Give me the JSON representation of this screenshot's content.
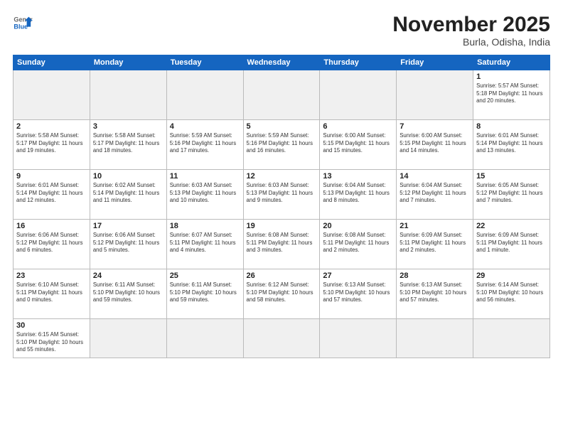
{
  "logo": {
    "general": "General",
    "blue": "Blue"
  },
  "header": {
    "month": "November 2025",
    "location": "Burla, Odisha, India"
  },
  "weekdays": [
    "Sunday",
    "Monday",
    "Tuesday",
    "Wednesday",
    "Thursday",
    "Friday",
    "Saturday"
  ],
  "days": [
    {
      "num": "",
      "info": ""
    },
    {
      "num": "",
      "info": ""
    },
    {
      "num": "",
      "info": ""
    },
    {
      "num": "",
      "info": ""
    },
    {
      "num": "",
      "info": ""
    },
    {
      "num": "",
      "info": ""
    },
    {
      "num": "1",
      "info": "Sunrise: 5:57 AM\nSunset: 5:18 PM\nDaylight: 11 hours\nand 20 minutes."
    },
    {
      "num": "2",
      "info": "Sunrise: 5:58 AM\nSunset: 5:17 PM\nDaylight: 11 hours\nand 19 minutes."
    },
    {
      "num": "3",
      "info": "Sunrise: 5:58 AM\nSunset: 5:17 PM\nDaylight: 11 hours\nand 18 minutes."
    },
    {
      "num": "4",
      "info": "Sunrise: 5:59 AM\nSunset: 5:16 PM\nDaylight: 11 hours\nand 17 minutes."
    },
    {
      "num": "5",
      "info": "Sunrise: 5:59 AM\nSunset: 5:16 PM\nDaylight: 11 hours\nand 16 minutes."
    },
    {
      "num": "6",
      "info": "Sunrise: 6:00 AM\nSunset: 5:15 PM\nDaylight: 11 hours\nand 15 minutes."
    },
    {
      "num": "7",
      "info": "Sunrise: 6:00 AM\nSunset: 5:15 PM\nDaylight: 11 hours\nand 14 minutes."
    },
    {
      "num": "8",
      "info": "Sunrise: 6:01 AM\nSunset: 5:14 PM\nDaylight: 11 hours\nand 13 minutes."
    },
    {
      "num": "9",
      "info": "Sunrise: 6:01 AM\nSunset: 5:14 PM\nDaylight: 11 hours\nand 12 minutes."
    },
    {
      "num": "10",
      "info": "Sunrise: 6:02 AM\nSunset: 5:14 PM\nDaylight: 11 hours\nand 11 minutes."
    },
    {
      "num": "11",
      "info": "Sunrise: 6:03 AM\nSunset: 5:13 PM\nDaylight: 11 hours\nand 10 minutes."
    },
    {
      "num": "12",
      "info": "Sunrise: 6:03 AM\nSunset: 5:13 PM\nDaylight: 11 hours\nand 9 minutes."
    },
    {
      "num": "13",
      "info": "Sunrise: 6:04 AM\nSunset: 5:13 PM\nDaylight: 11 hours\nand 8 minutes."
    },
    {
      "num": "14",
      "info": "Sunrise: 6:04 AM\nSunset: 5:12 PM\nDaylight: 11 hours\nand 7 minutes."
    },
    {
      "num": "15",
      "info": "Sunrise: 6:05 AM\nSunset: 5:12 PM\nDaylight: 11 hours\nand 7 minutes."
    },
    {
      "num": "16",
      "info": "Sunrise: 6:06 AM\nSunset: 5:12 PM\nDaylight: 11 hours\nand 6 minutes."
    },
    {
      "num": "17",
      "info": "Sunrise: 6:06 AM\nSunset: 5:12 PM\nDaylight: 11 hours\nand 5 minutes."
    },
    {
      "num": "18",
      "info": "Sunrise: 6:07 AM\nSunset: 5:11 PM\nDaylight: 11 hours\nand 4 minutes."
    },
    {
      "num": "19",
      "info": "Sunrise: 6:08 AM\nSunset: 5:11 PM\nDaylight: 11 hours\nand 3 minutes."
    },
    {
      "num": "20",
      "info": "Sunrise: 6:08 AM\nSunset: 5:11 PM\nDaylight: 11 hours\nand 2 minutes."
    },
    {
      "num": "21",
      "info": "Sunrise: 6:09 AM\nSunset: 5:11 PM\nDaylight: 11 hours\nand 2 minutes."
    },
    {
      "num": "22",
      "info": "Sunrise: 6:09 AM\nSunset: 5:11 PM\nDaylight: 11 hours\nand 1 minute."
    },
    {
      "num": "23",
      "info": "Sunrise: 6:10 AM\nSunset: 5:11 PM\nDaylight: 11 hours\nand 0 minutes."
    },
    {
      "num": "24",
      "info": "Sunrise: 6:11 AM\nSunset: 5:10 PM\nDaylight: 10 hours\nand 59 minutes."
    },
    {
      "num": "25",
      "info": "Sunrise: 6:11 AM\nSunset: 5:10 PM\nDaylight: 10 hours\nand 59 minutes."
    },
    {
      "num": "26",
      "info": "Sunrise: 6:12 AM\nSunset: 5:10 PM\nDaylight: 10 hours\nand 58 minutes."
    },
    {
      "num": "27",
      "info": "Sunrise: 6:13 AM\nSunset: 5:10 PM\nDaylight: 10 hours\nand 57 minutes."
    },
    {
      "num": "28",
      "info": "Sunrise: 6:13 AM\nSunset: 5:10 PM\nDaylight: 10 hours\nand 57 minutes."
    },
    {
      "num": "29",
      "info": "Sunrise: 6:14 AM\nSunset: 5:10 PM\nDaylight: 10 hours\nand 56 minutes."
    },
    {
      "num": "30",
      "info": "Sunrise: 6:15 AM\nSunset: 5:10 PM\nDaylight: 10 hours\nand 55 minutes."
    },
    {
      "num": "",
      "info": ""
    },
    {
      "num": "",
      "info": ""
    },
    {
      "num": "",
      "info": ""
    },
    {
      "num": "",
      "info": ""
    },
    {
      "num": "",
      "info": ""
    },
    {
      "num": "",
      "info": ""
    }
  ]
}
